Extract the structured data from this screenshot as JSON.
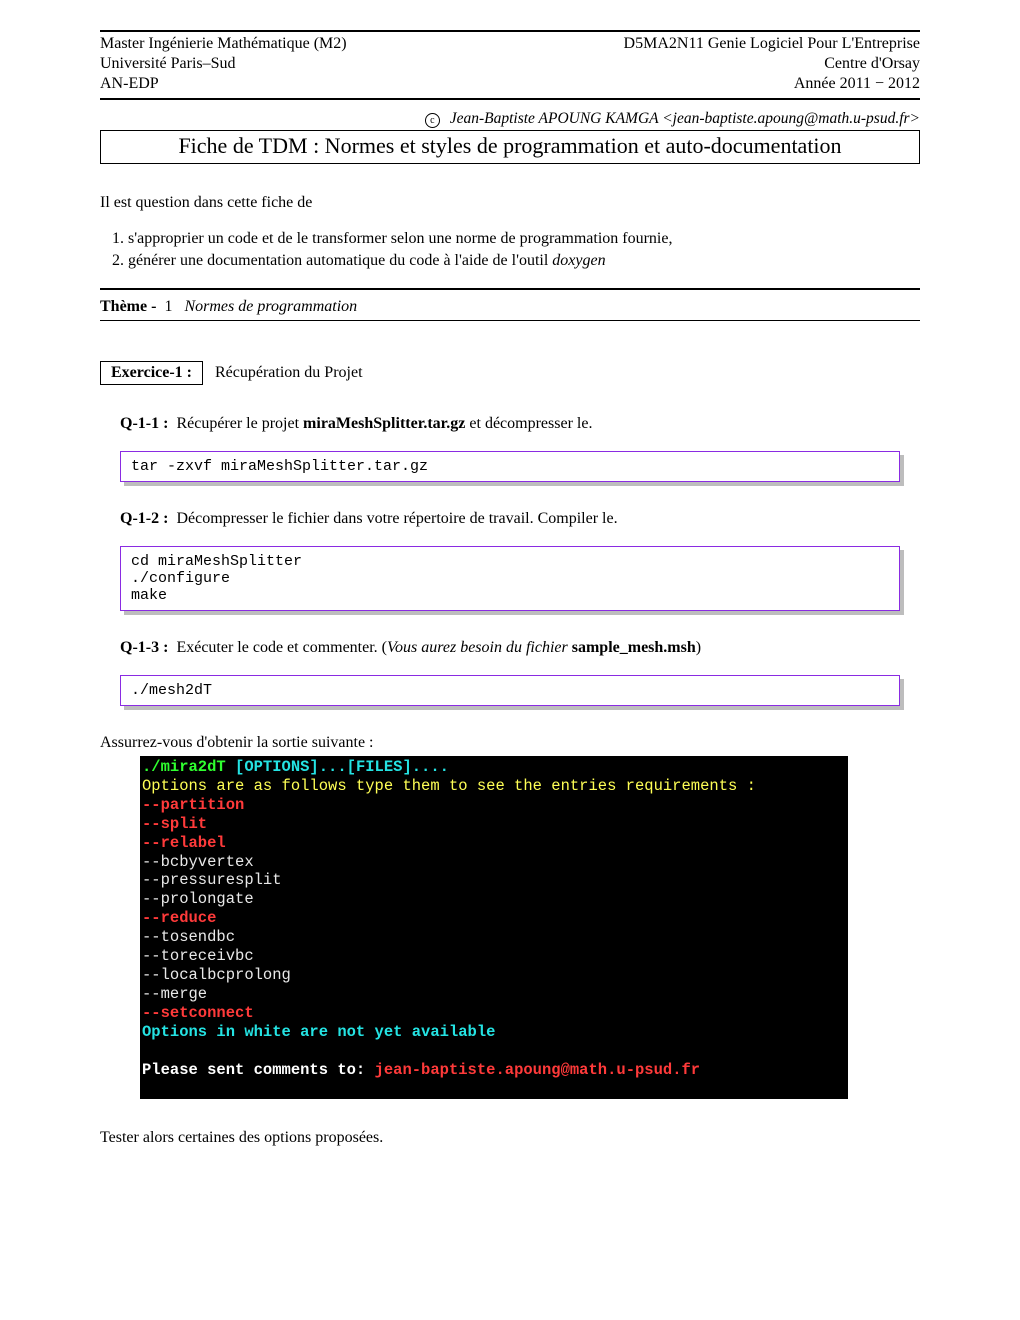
{
  "header": {
    "left1": "Master Ingénierie Mathématique (M2)",
    "right1": "D5MA2N11 Genie Logiciel Pour L'Entreprise",
    "left2": "Université Paris–Sud",
    "right2": "Centre d'Orsay",
    "left3": "AN-EDP",
    "right3": "Année 2011 − 2012"
  },
  "copyright": {
    "symbol": "c",
    "text": "Jean-Baptiste APOUNG KAMGA <jean-baptiste.apoung@math.u-psud.fr>"
  },
  "title": "Fiche de TDM : Normes et styles de programmation et auto-documentation",
  "intro": "Il est question dans cette fiche de",
  "goals": [
    "s'approprier un code et de le transformer selon une norme de programmation fournie,",
    "générer une documentation automatique du code à l'aide de l'outil doxygen"
  ],
  "goals_tool_word": "doxygen",
  "theme": {
    "label": "Thème -",
    "num": "1",
    "title": "Normes de programmation"
  },
  "exercise": {
    "box": "Exercice-1   :",
    "title": "Récupération du Projet"
  },
  "q11": {
    "label": "Q-1-1   :",
    "plain1": "Récupérer le projet ",
    "bold": "miraMeshSplitter.tar.gz",
    "plain2": " et décompresser le."
  },
  "code1": "tar -zxvf miraMeshSplitter.tar.gz",
  "q12": {
    "label": "Q-1-2   :",
    "text": "Décompresser le fichier dans votre répertoire de travail. Compiler le."
  },
  "code2": "cd miraMeshSplitter\n./configure\nmake",
  "q13": {
    "label": "Q-1-3   :",
    "plain1": "Exécuter le code et commenter. (",
    "italic": "Vous aurez besoin du fichier ",
    "bold": "sample_mesh.msh",
    "plain2": ")"
  },
  "code3": "./mesh2dT",
  "assure": "Assurrez-vous d'obtenir la sortie suivante :",
  "terminal": {
    "line1_a": "./mira2dT",
    "line1_b": " [OPTIONS]...[FILES]....",
    "line2": "Options are as follows type them to see the entries requirements :",
    "opts_red": [
      "--partition",
      "--split",
      "--relabel"
    ],
    "opts_white1": [
      " --bcbyvertex",
      " --pressuresplit",
      " --prolongate"
    ],
    "opts_red2": [
      "--reduce"
    ],
    "opts_white2": [
      " --tosendbc",
      " --toreceivbc",
      " --localbcprolong",
      " --merge"
    ],
    "opts_red3": [
      "--setconnect"
    ],
    "note": "Options in white are not yet available",
    "please_a": " Please sent comments to:  ",
    "please_b": "jean-baptiste.apoung@math.u-psud.fr"
  },
  "tester": "Tester alors certaines des options proposées."
}
